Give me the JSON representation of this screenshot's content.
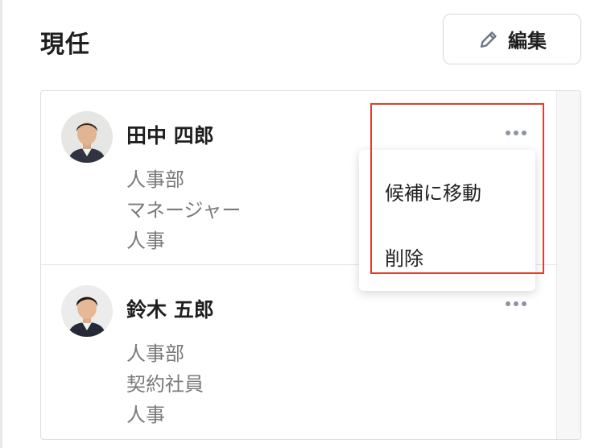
{
  "section": {
    "title": "現任"
  },
  "toolbar": {
    "edit_label": "編集",
    "edit_icon": "pencil-icon"
  },
  "members": [
    {
      "name": "田中 四郎",
      "department": "人事部",
      "position": "マネージャー",
      "role": "人事"
    },
    {
      "name": "鈴木 五郎",
      "department": "人事部",
      "position": "契約社員",
      "role": "人事"
    }
  ],
  "menu": {
    "move_to_candidates": "候補に移動",
    "delete": "削除"
  },
  "colors": {
    "highlight": "#d9402f",
    "more_dots": "#8c93a3",
    "secondary_text": "#7a7a7a"
  }
}
